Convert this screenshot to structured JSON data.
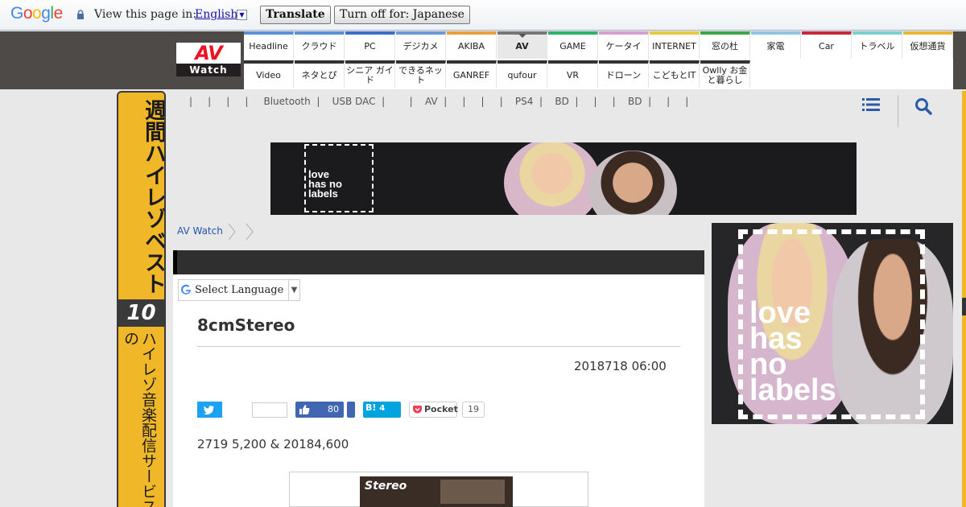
{
  "translate_bar": {
    "logo_text": "Google",
    "view_label": "View this page in:",
    "language": "English",
    "translate_button": "Translate",
    "turn_off_button": "Turn off for: Japanese",
    "logo_colors": [
      "#4285f4",
      "#ea4335",
      "#fbbc05",
      "#4285f4",
      "#34a853",
      "#ea4335"
    ]
  },
  "site": {
    "logo_main": "AV",
    "logo_sub": "Watch"
  },
  "nav": {
    "row1": [
      {
        "label": "Headline",
        "color": "#5b8fd6"
      },
      {
        "label": "クラウド",
        "color": "#5b8fd6"
      },
      {
        "label": "PC",
        "color": "#3a6fc8"
      },
      {
        "label": "デジカメ",
        "color": "#6a9ad8"
      },
      {
        "label": "AKIBA",
        "color": "#e8a03a"
      },
      {
        "label": "AV",
        "color": "#777777"
      },
      {
        "label": "GAME",
        "color": "#2fb36b"
      },
      {
        "label": "ケータイ",
        "color": "#d8a0d0"
      },
      {
        "label": "INTERNET",
        "color": "#e8c840"
      },
      {
        "label": "窓の杜",
        "color": "#3aa84a"
      },
      {
        "label": "家電",
        "color": "#8fc3e8"
      },
      {
        "label": "Car",
        "color": "#c8283a"
      },
      {
        "label": "トラベル",
        "color": "#7ad0d0"
      },
      {
        "label": "仮想通貨",
        "color": "#e8b830"
      }
    ],
    "row2": [
      {
        "label": "Video"
      },
      {
        "label": "ネタとぴ"
      },
      {
        "label": "シニア ガイド"
      },
      {
        "label": "できるネット"
      },
      {
        "label": "GANREF"
      },
      {
        "label": "qufour"
      },
      {
        "label": "VR"
      },
      {
        "label": "ドローン"
      },
      {
        "label": "こどもとIT"
      },
      {
        "label": "Owlly お金と暮らし"
      }
    ]
  },
  "keywords": "|     |     |     |     Bluetooth  |    USB DAC  |        |    AV  |     |     |     |    PS4  |    BD  |     |     |    BD  |     |     |",
  "side_banner": {
    "top": "週間ハイレゾベスト",
    "rank": "10",
    "bottom": "ハイレゾ音楽配信サービスの"
  },
  "ads": {
    "top_text": "love has no labels",
    "right_text": "love has no labels"
  },
  "breadcrumb": {
    "home": "AV Watch"
  },
  "article": {
    "select_language": "Select Language",
    "title": "8cmStereo",
    "date": "2018718 06:00",
    "share": {
      "facebook_count": "80",
      "hatena_label": "B!",
      "hatena_count": "4",
      "pocket_label": "Pocket",
      "pocket_count": "19"
    },
    "body": "2719 5,200 & 20184,600",
    "image_caption": "Stereo"
  }
}
